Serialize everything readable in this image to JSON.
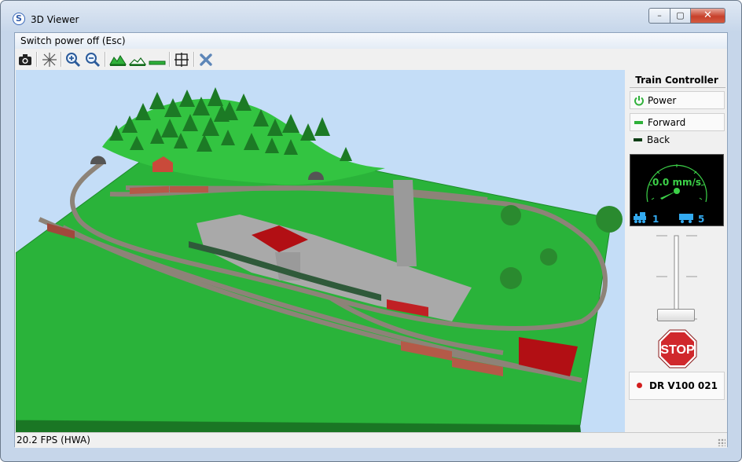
{
  "window": {
    "title": "3D Viewer",
    "buttons": {
      "minimize": "–",
      "maximize": "▢",
      "close": "✕"
    }
  },
  "menu": {
    "items": [
      "Switch power off (Esc)"
    ]
  },
  "toolbar": {
    "buttons": [
      "camera-icon",
      "center-icon",
      "zoom-in-icon",
      "zoom-out-icon",
      "view-high-icon",
      "view-medium-icon",
      "view-flat-icon",
      "fit-view-icon",
      "close-layout-icon"
    ]
  },
  "controller": {
    "title": "Train Controller",
    "power_label": "Power",
    "forward_label": "Forward",
    "back_label": "Back",
    "speed": "0.0 mm/s",
    "loco_count": "1",
    "wagon_count": "5",
    "stop_label": "STOP",
    "loco_name": "DR V100 021",
    "throttle_fraction": 0,
    "colors": {
      "gauge_bg": "#000000",
      "gauge_green": "#3cd148",
      "count_blue": "#33aaf0",
      "stop_red": "#d0282c"
    }
  },
  "status": {
    "fps": "20.2 FPS (HWA)"
  }
}
